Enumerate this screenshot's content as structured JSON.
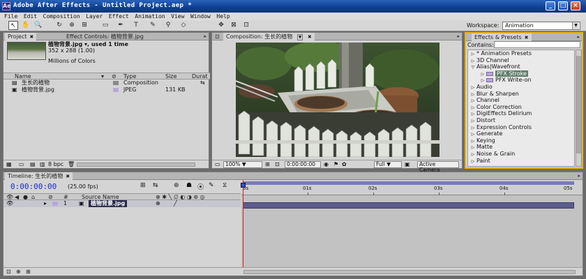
{
  "window": {
    "title": "Adobe After Effects - Untitled Project.aep *",
    "app_icon": "Ae"
  },
  "menu": [
    "File",
    "Edit",
    "Composition",
    "Layer",
    "Effect",
    "Animation",
    "View",
    "Window",
    "Help"
  ],
  "toolbar": {
    "tools": [
      "selection-tool",
      "hand-tool",
      "zoom-tool",
      "rotation-tool",
      "orbit-camera-tool",
      "pan-behind-tool",
      "mask-tool",
      "pen-tool",
      "text-tool",
      "brush-tool",
      "clone-stamp-tool",
      "eraser-tool"
    ],
    "workspace_label": "Workspace:",
    "workspace_value": "Animation"
  },
  "project_panel": {
    "tabs": [
      "Project",
      "Effect Controls: 植物背景.jpg"
    ],
    "selected_item": {
      "name": "植物背景.jpg ▾, used 1 time",
      "dimensions": "352 x 288 (1.00)",
      "colors": "Millions of Colors"
    },
    "columns": [
      "Name",
      "Type",
      "Size",
      "Durat"
    ],
    "items": [
      {
        "name": "生长的植物",
        "type": "Composition",
        "size": "",
        "swatch": "#8a8a8a"
      },
      {
        "name": "植物背景.jpg",
        "type": "JPEG",
        "size": "131 KB",
        "swatch": "#b7a8d8"
      }
    ],
    "footer_bpc": "8 bpc"
  },
  "composition_panel": {
    "tab": "Composition: 生长的植物",
    "zoom": "100%",
    "timecode": "0:00:00:00",
    "resolution": "Full",
    "camera": "Active Camera"
  },
  "effects_panel": {
    "tab": "Effects & Presets",
    "contains_label": "Contains:",
    "contains_value": "",
    "items": [
      {
        "label": "* Animation Presets",
        "level": 0,
        "tri": "right"
      },
      {
        "label": "3D Channel",
        "level": 0,
        "tri": "right"
      },
      {
        "label": "Alias|Wavefront",
        "level": 0,
        "tri": "down"
      },
      {
        "label": "PFX Stroke",
        "level": 1,
        "tri": "right",
        "fx": true,
        "selected": true
      },
      {
        "label": "PFX Write-on",
        "level": 1,
        "tri": "right",
        "fx": true
      },
      {
        "label": "Audio",
        "level": 0,
        "tri": "right"
      },
      {
        "label": "Blur & Sharpen",
        "level": 0,
        "tri": "right"
      },
      {
        "label": "Channel",
        "level": 0,
        "tri": "right"
      },
      {
        "label": "Color Correction",
        "level": 0,
        "tri": "right"
      },
      {
        "label": "DigiEffects Delirium",
        "level": 0,
        "tri": "right"
      },
      {
        "label": "Distort",
        "level": 0,
        "tri": "right"
      },
      {
        "label": "Expression Controls",
        "level": 0,
        "tri": "right"
      },
      {
        "label": "Generate",
        "level": 0,
        "tri": "right"
      },
      {
        "label": "Keying",
        "level": 0,
        "tri": "right"
      },
      {
        "label": "Matte",
        "level": 0,
        "tri": "right"
      },
      {
        "label": "Noise & Grain",
        "level": 0,
        "tri": "right"
      },
      {
        "label": "Paint",
        "level": 0,
        "tri": "right"
      }
    ]
  },
  "timeline": {
    "tab": "Timeline: 生长的植物",
    "timecode": "0:00:00:00",
    "fps": "(25.00 fps)",
    "header": {
      "number": "#",
      "source_name": "Source Name"
    },
    "layers": [
      {
        "number": "1",
        "name": "植物背景.jpg"
      }
    ],
    "ruler": [
      "0s",
      "01s",
      "02s",
      "03s",
      "04s",
      "05s"
    ]
  }
}
